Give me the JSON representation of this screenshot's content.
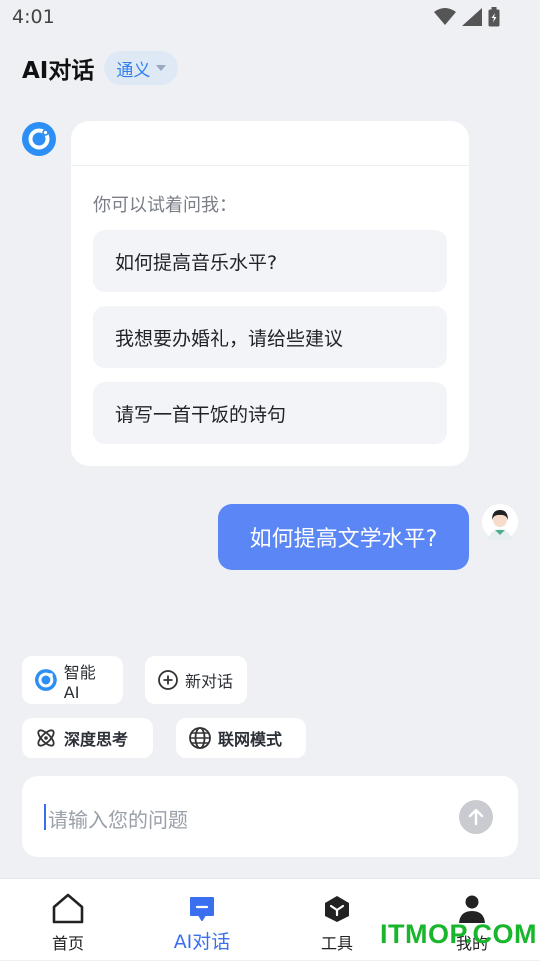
{
  "status_bar": {
    "time": "4:01"
  },
  "header": {
    "title": "AI对话",
    "model": "通义"
  },
  "bot_card": {
    "hint": "你可以试着问我：",
    "suggestions": [
      "如何提高音乐水平?",
      "我想要办婚礼，请给些建议",
      "请写一首干饭的诗句"
    ]
  },
  "user_message": "如何提高文学水平?",
  "chips": {
    "smart_ai": "智能AI",
    "new_chat": "新对话",
    "deep_think": "深度思考",
    "web_mode": "联网模式"
  },
  "input": {
    "placeholder": "请输入您的问题"
  },
  "nav": {
    "home": "首页",
    "ai_chat": "AI对话",
    "tools": "工具",
    "mine": "我的"
  },
  "watermark": "ITMOP.COM",
  "colors": {
    "accent": "#3a70f0",
    "user_bubble": "#5b86f6",
    "background": "#eef0f4",
    "watermark": "#18b62b"
  },
  "icons": [
    "wifi-icon",
    "signal-icon",
    "battery-icon",
    "chevron-down-icon",
    "bot-avatar-icon",
    "user-avatar-icon",
    "plus-circle-icon",
    "atom-icon",
    "globe-icon",
    "send-arrow-icon",
    "home-icon",
    "chat-icon",
    "tools-cube-icon",
    "person-icon"
  ]
}
